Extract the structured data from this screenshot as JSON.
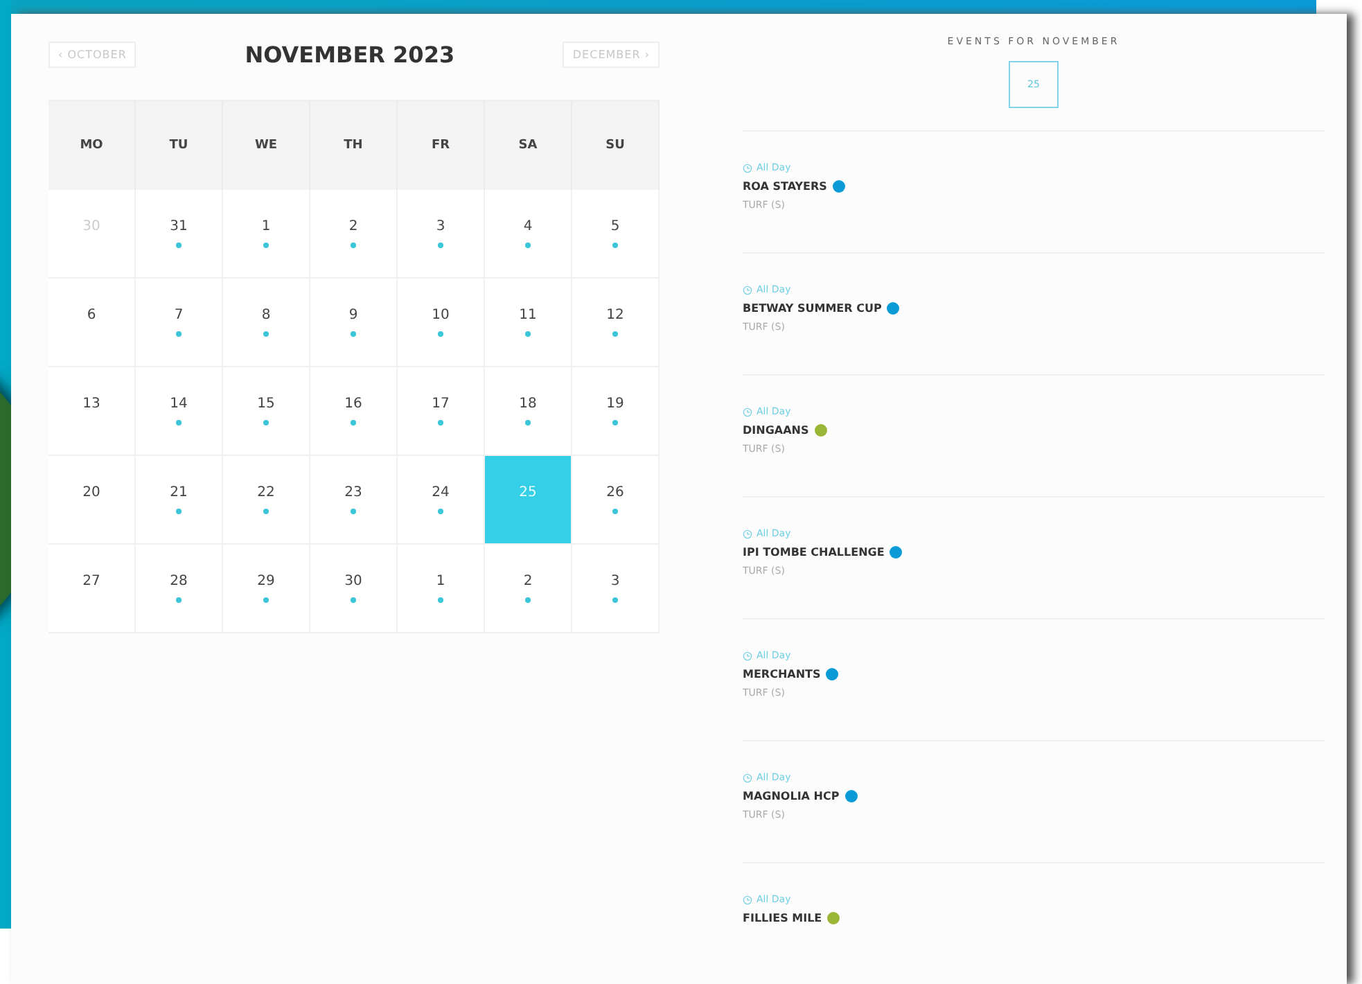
{
  "calendar": {
    "prev_month": "‹ OCTOBER",
    "title": "NOVEMBER 2023",
    "next_month": "DECEMBER ›",
    "weekdays": [
      "MO",
      "TU",
      "WE",
      "TH",
      "FR",
      "SA",
      "SU"
    ],
    "weeks": [
      [
        {
          "day": "30",
          "muted": true,
          "has_event": false,
          "selected": false
        },
        {
          "day": "31",
          "muted": false,
          "has_event": true,
          "selected": false
        },
        {
          "day": "1",
          "muted": false,
          "has_event": true,
          "selected": false
        },
        {
          "day": "2",
          "muted": false,
          "has_event": true,
          "selected": false
        },
        {
          "day": "3",
          "muted": false,
          "has_event": true,
          "selected": false
        },
        {
          "day": "4",
          "muted": false,
          "has_event": true,
          "selected": false
        },
        {
          "day": "5",
          "muted": false,
          "has_event": true,
          "selected": false
        }
      ],
      [
        {
          "day": "6",
          "muted": false,
          "has_event": false,
          "selected": false
        },
        {
          "day": "7",
          "muted": false,
          "has_event": true,
          "selected": false
        },
        {
          "day": "8",
          "muted": false,
          "has_event": true,
          "selected": false
        },
        {
          "day": "9",
          "muted": false,
          "has_event": true,
          "selected": false
        },
        {
          "day": "10",
          "muted": false,
          "has_event": true,
          "selected": false
        },
        {
          "day": "11",
          "muted": false,
          "has_event": true,
          "selected": false
        },
        {
          "day": "12",
          "muted": false,
          "has_event": true,
          "selected": false
        }
      ],
      [
        {
          "day": "13",
          "muted": false,
          "has_event": false,
          "selected": false
        },
        {
          "day": "14",
          "muted": false,
          "has_event": true,
          "selected": false
        },
        {
          "day": "15",
          "muted": false,
          "has_event": true,
          "selected": false
        },
        {
          "day": "16",
          "muted": false,
          "has_event": true,
          "selected": false
        },
        {
          "day": "17",
          "muted": false,
          "has_event": true,
          "selected": false
        },
        {
          "day": "18",
          "muted": false,
          "has_event": true,
          "selected": false
        },
        {
          "day": "19",
          "muted": false,
          "has_event": true,
          "selected": false
        }
      ],
      [
        {
          "day": "20",
          "muted": false,
          "has_event": false,
          "selected": false
        },
        {
          "day": "21",
          "muted": false,
          "has_event": true,
          "selected": false
        },
        {
          "day": "22",
          "muted": false,
          "has_event": true,
          "selected": false
        },
        {
          "day": "23",
          "muted": false,
          "has_event": true,
          "selected": false
        },
        {
          "day": "24",
          "muted": false,
          "has_event": true,
          "selected": false
        },
        {
          "day": "25",
          "muted": false,
          "has_event": false,
          "selected": true
        },
        {
          "day": "26",
          "muted": false,
          "has_event": true,
          "selected": false
        }
      ],
      [
        {
          "day": "27",
          "muted": false,
          "has_event": false,
          "selected": false
        },
        {
          "day": "28",
          "muted": false,
          "has_event": true,
          "selected": false
        },
        {
          "day": "29",
          "muted": false,
          "has_event": true,
          "selected": false
        },
        {
          "day": "30",
          "muted": false,
          "has_event": true,
          "selected": false
        },
        {
          "day": "1",
          "muted": false,
          "has_event": true,
          "selected": false
        },
        {
          "day": "2",
          "muted": false,
          "has_event": true,
          "selected": false
        },
        {
          "day": "3",
          "muted": false,
          "has_event": true,
          "selected": false
        }
      ]
    ]
  },
  "events": {
    "title": "EVENTS FOR NOVEMBER",
    "selected_day": "25",
    "items": [
      {
        "time": "All Day",
        "name": "ROA STAYERS",
        "color": "#0a9ad6",
        "surface": "TURF (S)"
      },
      {
        "time": "All Day",
        "name": "BETWAY SUMMER CUP",
        "color": "#0a9ad6",
        "surface": "TURF (S)"
      },
      {
        "time": "All Day",
        "name": "DINGAANS",
        "color": "#9bb536",
        "surface": "TURF (S)"
      },
      {
        "time": "All Day",
        "name": "IPI TOMBE CHALLENGE",
        "color": "#0a9ad6",
        "surface": "TURF (S)"
      },
      {
        "time": "All Day",
        "name": "MERCHANTS",
        "color": "#0a9ad6",
        "surface": "TURF (S)"
      },
      {
        "time": "All Day",
        "name": "MAGNOLIA HCP",
        "color": "#0a9ad6",
        "surface": "TURF (S)"
      },
      {
        "time": "All Day",
        "name": "FILLIES MILE",
        "color": "#9bb536"
      }
    ]
  }
}
